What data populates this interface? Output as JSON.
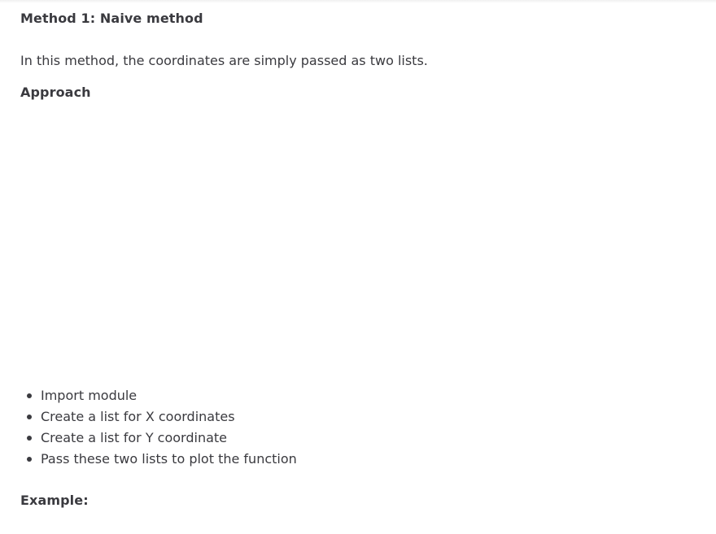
{
  "article": {
    "method_heading": "Method 1: Naive method",
    "intro": "In this method, the coordinates are simply passed as two lists.",
    "approach_heading": "Approach",
    "steps": [
      "Import module",
      "Create a list for X coordinates",
      "Create a list for Y coordinate",
      "Pass these two lists to plot the function"
    ],
    "example_heading": "Example:"
  }
}
